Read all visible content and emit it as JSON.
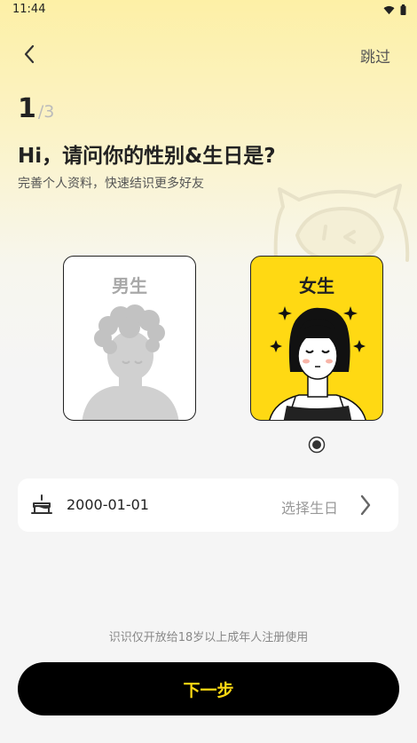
{
  "status_bar": {
    "time": "11:44",
    "icons": [
      "wifi-icon",
      "battery-icon"
    ]
  },
  "header": {
    "back_icon": "chevron-left-icon",
    "skip_label": "跳过"
  },
  "step": {
    "current": "1",
    "total": "/3"
  },
  "title": "Hi，请问你的性别&生日是?",
  "subtitle": "完善个人资料，快速结识更多好友",
  "gender": {
    "options": [
      {
        "key": "male",
        "label": "男生",
        "selected": false
      },
      {
        "key": "female",
        "label": "女生",
        "selected": true
      }
    ]
  },
  "birthday": {
    "icon": "cake-icon",
    "value": "2000-01-01",
    "hint": "选择生日",
    "arrow_icon": "chevron-right-icon"
  },
  "notice": "识识仅开放给18岁以上成年人注册使用",
  "next_button": {
    "label": "下一步"
  },
  "colors": {
    "accent": "#ffd913",
    "button": "#000000",
    "background": "#f5f5f5"
  }
}
